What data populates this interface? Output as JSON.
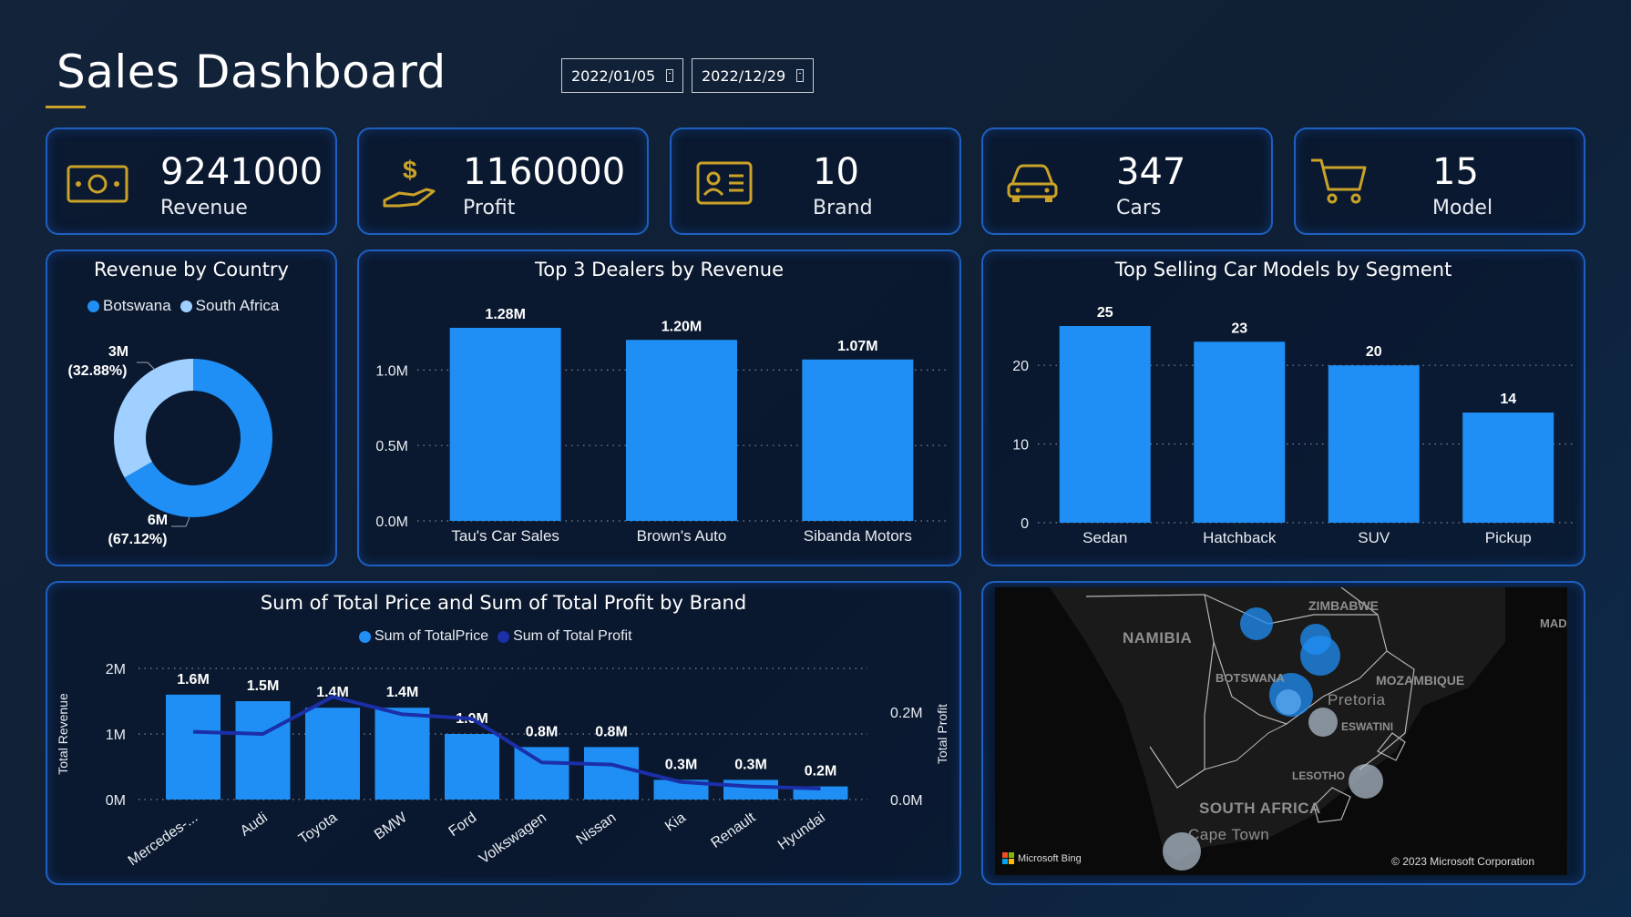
{
  "header": {
    "title": "Sales Dashboard",
    "start_date": "2022/01/05",
    "end_date": "2022/12/29"
  },
  "kpis": [
    {
      "value": "9241000",
      "label": "Revenue",
      "icon": "money-icon"
    },
    {
      "value": "1160000",
      "label": "Profit",
      "icon": "hand-dollar-icon"
    },
    {
      "value": "10",
      "label": "Brand",
      "icon": "id-card-icon"
    },
    {
      "value": "347",
      "label": "Cars",
      "icon": "car-icon"
    },
    {
      "value": "15",
      "label": "Model",
      "icon": "cart-icon"
    }
  ],
  "colors": {
    "primary_bar": "#1f8ff5",
    "light_series": "#9fd0ff",
    "line_series": "#1b2fa8",
    "card_border": "#1e5fbf",
    "icon_gold": "#c9a227"
  },
  "revenue_by_country": {
    "title": "Revenue by Country",
    "legend": [
      "Botswana",
      "South Africa"
    ],
    "label_small": "3M",
    "label_small_pct": "(32.88%)",
    "label_large": "6M",
    "label_large_pct": "(67.12%)"
  },
  "top_dealers": {
    "title": "Top 3 Dealers by Revenue"
  },
  "top_models": {
    "title": "Top Selling Car Models by Segment"
  },
  "price_profit": {
    "title": "Sum of Total Price and Sum of Total Profit by Brand",
    "legend": [
      "Sum of TotalPrice",
      "Sum of Total Profit"
    ],
    "y_left_label": "Total Revenue",
    "y_right_label": "Total Profit"
  },
  "map": {
    "labels": {
      "namibia": "NAMIBIA",
      "zimbabwe": "ZIMBABWE",
      "botswana": "BOTSWANA",
      "mozambique": "MOZAMBIQUE",
      "pretoria": "Pretoria",
      "eswatini": "ESWATINI",
      "lesotho": "LESOTHO",
      "south_africa": "SOUTH AFRICA",
      "cape_town": "Cape Town",
      "mad": "MAD"
    },
    "brand": "Microsoft Bing",
    "copyright": "© 2023 Microsoft Corporation"
  },
  "chart_data": [
    {
      "type": "pie",
      "title": "Revenue by Country",
      "categories": [
        "Botswana",
        "South Africa"
      ],
      "values": [
        6,
        3
      ],
      "percent": [
        67.12,
        32.88
      ],
      "legend": "top"
    },
    {
      "type": "bar",
      "title": "Top 3 Dealers by Revenue",
      "categories": [
        "Tau's Car Sales",
        "Brown's Auto",
        "Sibanda Motors"
      ],
      "values": [
        1.28,
        1.2,
        1.07
      ],
      "value_labels": [
        "1.28M",
        "1.20M",
        "1.07M"
      ],
      "yticks": [
        "0.0M",
        "0.5M",
        "1.0M"
      ],
      "ylim": [
        0,
        1.28
      ],
      "grid": true
    },
    {
      "type": "bar",
      "title": "Top Selling Car Models by Segment",
      "categories": [
        "Sedan",
        "Hatchback",
        "SUV",
        "Pickup"
      ],
      "values": [
        25,
        23,
        20,
        14
      ],
      "yticks": [
        "0",
        "10",
        "20"
      ],
      "ylim": [
        0,
        25
      ],
      "grid": true
    },
    {
      "type": "bar",
      "title": "Sum of Total Price and Sum of Total Profit by Brand",
      "categories": [
        "Mercedes-...",
        "Audi",
        "Toyota",
        "BMW",
        "Ford",
        "Volkswagen",
        "Nissan",
        "Kia",
        "Renault",
        "Hyundai"
      ],
      "series": [
        {
          "name": "Sum of TotalPrice",
          "type": "bar",
          "axis": "left",
          "values": [
            1.6,
            1.5,
            1.4,
            1.4,
            1.0,
            0.8,
            0.8,
            0.3,
            0.3,
            0.2
          ],
          "labels": [
            "1.6M",
            "1.5M",
            "1.4M",
            "1.4M",
            "1.0M",
            "0.8M",
            "0.8M",
            "0.3M",
            "0.3M",
            "0.2M"
          ]
        },
        {
          "name": "Sum of Total Profit",
          "type": "line",
          "axis": "right",
          "values": [
            0.155,
            0.15,
            0.235,
            0.195,
            0.185,
            0.085,
            0.08,
            0.04,
            0.03,
            0.025
          ]
        }
      ],
      "y_left": {
        "label": "Total Revenue",
        "ticks": [
          "0M",
          "1M",
          "2M"
        ],
        "range": [
          0,
          2
        ]
      },
      "y_right": {
        "label": "Total Profit",
        "ticks": [
          "0.0M",
          "0.2M"
        ],
        "range": [
          0,
          0.3
        ]
      },
      "legend": "top",
      "grid": true
    }
  ]
}
